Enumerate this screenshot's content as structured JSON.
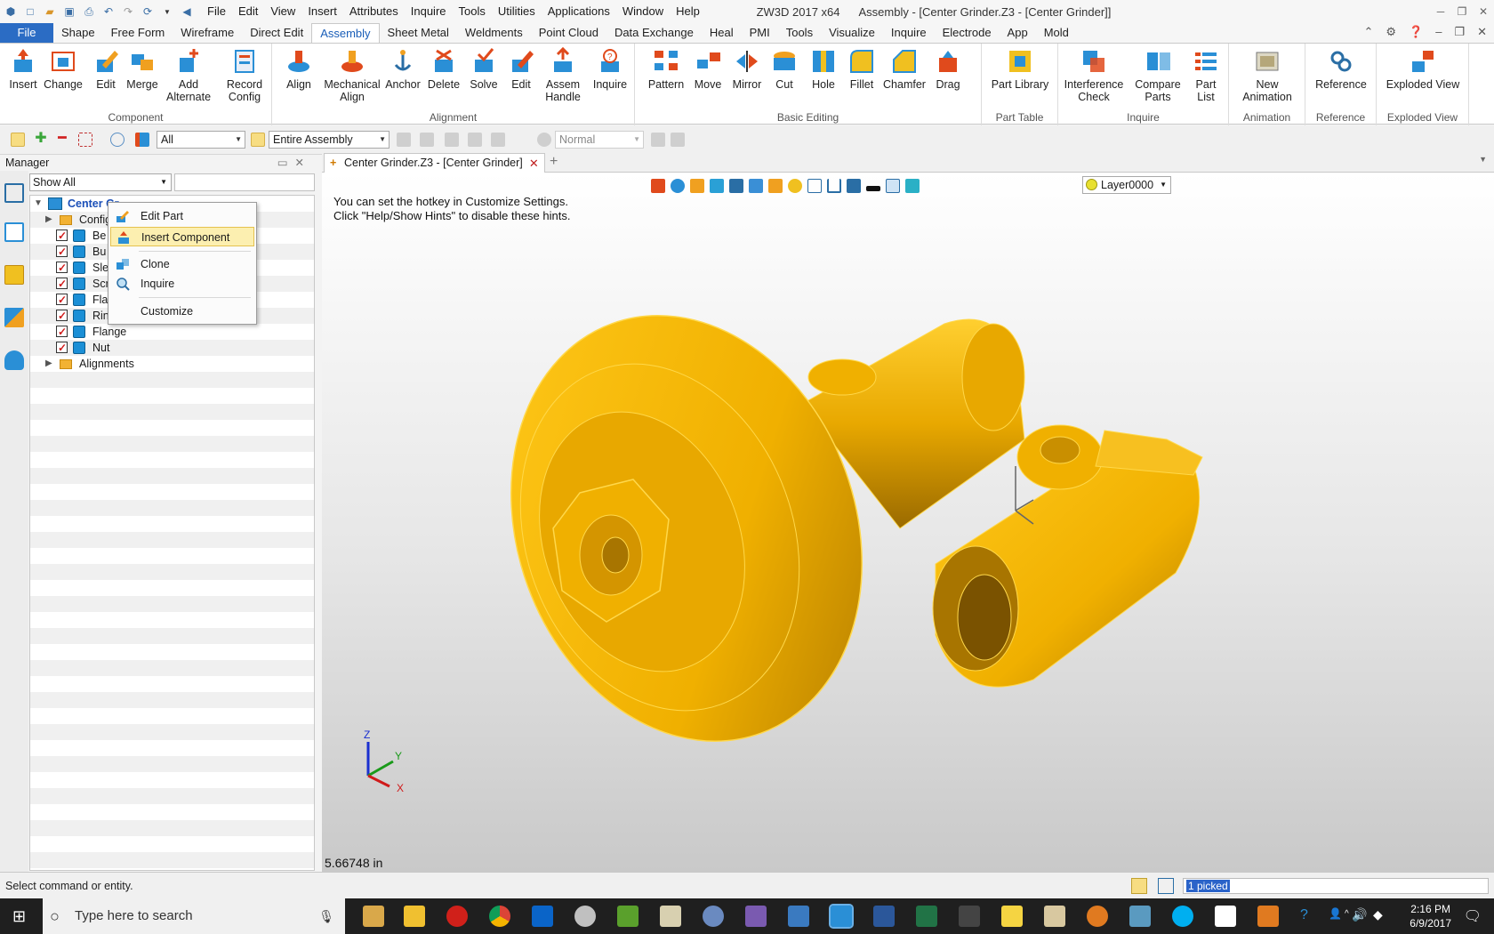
{
  "window": {
    "app_title": "ZW3D 2017 x64",
    "doc_title": "Assembly - [Center Grinder.Z3 - [Center Grinder]]"
  },
  "menubar": [
    "File",
    "Edit",
    "View",
    "Insert",
    "Attributes",
    "Inquire",
    "Tools",
    "Utilities",
    "Applications",
    "Window",
    "Help"
  ],
  "ribbon_tabs": [
    "File",
    "Shape",
    "Free Form",
    "Wireframe",
    "Direct Edit",
    "Assembly",
    "Sheet Metal",
    "Weldments",
    "Point Cloud",
    "Data Exchange",
    "Heal",
    "PMI",
    "Tools",
    "Visualize",
    "Inquire",
    "Electrode",
    "App",
    "Mold"
  ],
  "active_tab": "Assembly",
  "ribbon": {
    "component": {
      "name": "Component",
      "buttons": [
        "Insert",
        "Change",
        "Edit",
        "Merge",
        "Add Alternate",
        "Record Config"
      ]
    },
    "alignment": {
      "name": "Alignment",
      "buttons": [
        "Align",
        "Mechanical Align",
        "Anchor",
        "Delete",
        "Solve",
        "Edit",
        "Assem Handle",
        "Inquire"
      ]
    },
    "basic_editing": {
      "name": "Basic Editing",
      "buttons": [
        "Pattern",
        "Move",
        "Mirror",
        "Cut",
        "Hole",
        "Fillet",
        "Chamfer",
        "Drag"
      ]
    },
    "part_table": {
      "name": "Part Table",
      "buttons": [
        "Part Library"
      ]
    },
    "inquire": {
      "name": "Inquire",
      "buttons": [
        "Interference Check",
        "Compare Parts",
        "Part List"
      ]
    },
    "animation": {
      "name": "Animation",
      "buttons": [
        "New Animation"
      ]
    },
    "reference": {
      "name": "Reference",
      "buttons": [
        "Reference"
      ]
    },
    "exploded": {
      "name": "Exploded View",
      "buttons": [
        "Exploded View"
      ]
    }
  },
  "toolbar2": {
    "filter": "All",
    "scope": "Entire Assembly",
    "mode": "Normal"
  },
  "manager": {
    "title": "Manager",
    "filter": "Show All",
    "tree": [
      {
        "label": "Center Gr...",
        "type": "root"
      },
      {
        "label": "Config",
        "type": "folder"
      },
      {
        "label": "Be",
        "type": "part"
      },
      {
        "label": "Bu",
        "type": "part"
      },
      {
        "label": "Sle",
        "type": "part"
      },
      {
        "label": "Scr",
        "type": "part"
      },
      {
        "label": "Fla",
        "type": "part"
      },
      {
        "label": "Rin",
        "type": "part"
      },
      {
        "label": "Flange",
        "type": "part"
      },
      {
        "label": "Nut",
        "type": "part"
      },
      {
        "label": "Alignments",
        "type": "folder"
      }
    ]
  },
  "context_menu": {
    "items": [
      "Edit Part",
      "Insert Component",
      "Clone",
      "Inquire",
      "Customize"
    ],
    "highlighted": "Insert Component"
  },
  "document_tab": "Center Grinder.Z3 - [Center Grinder]",
  "viewport": {
    "hint_line1": "You can set the hotkey in Customize Settings.",
    "hint_line2": "Click \"Help/Show Hints\" to disable these hints.",
    "layer": "Layer0000",
    "measure": "5.66748 in",
    "axis_labels": [
      "Z",
      "Y",
      "X"
    ]
  },
  "status": {
    "message": "Select command or entity.",
    "picked": "1 picked"
  },
  "taskbar": {
    "search_placeholder": "Type here to search",
    "time": "2:16 PM",
    "date": "6/9/2017"
  },
  "colors": {
    "part": "#f2b600",
    "accent": "#2b6cc4",
    "highlight": "#fcefb0"
  }
}
